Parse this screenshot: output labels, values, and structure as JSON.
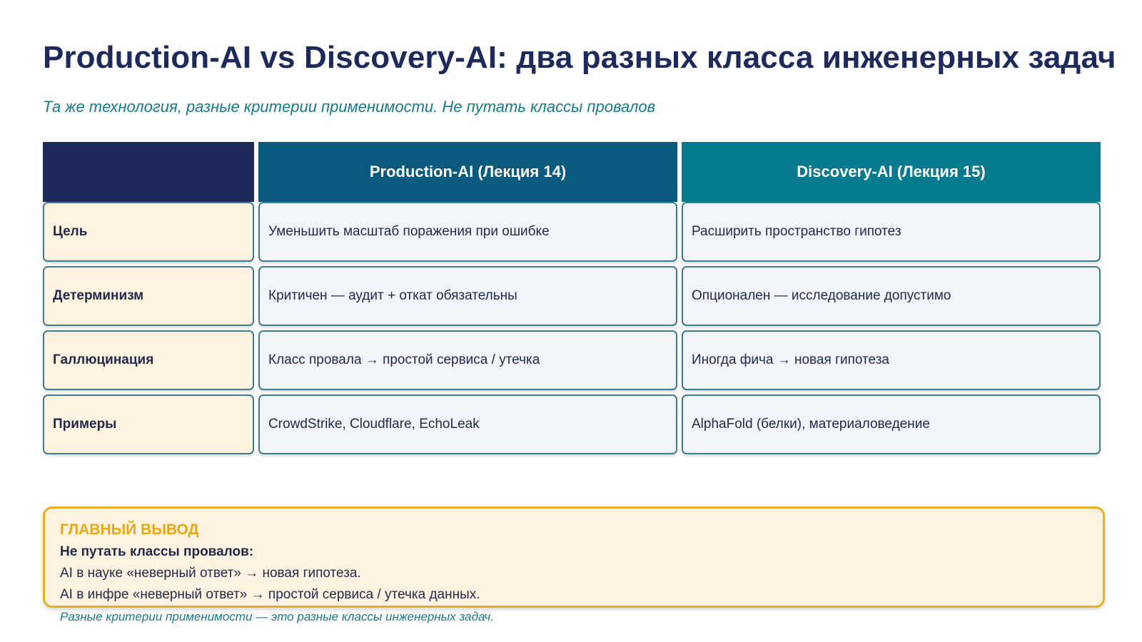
{
  "title": "Production-AI vs Discovery-AI: два разных класса инженерных задач",
  "subtitle": "Та же технология, разные критерии применимости. Не путать классы провалов",
  "colors": {
    "title": "#1f2a5c",
    "subtitle": "#167a8c",
    "header_corner": "#1f2a5c",
    "header_production": "#0b5a7e",
    "header_discovery": "#067b8f",
    "label_cell_bg": "#fdf3e0",
    "data_cell_bg": "#f1f5f9",
    "cell_border": "#3f7d8d",
    "conclusion_border": "#e8b020",
    "conclusion_label": "#e8a813"
  },
  "table": {
    "headers": [
      "",
      "Production-AI (Лекция 14)",
      "Discovery-AI (Лекция 15)"
    ],
    "rows": [
      {
        "label": "Цель",
        "production": "Уменьшить масштаб поражения при ошибке",
        "discovery": "Расширить пространство гипотез"
      },
      {
        "label": "Детерминизм",
        "production": "Критичен — аудит + откат обязательны",
        "discovery": "Опционален — исследование допустимо"
      },
      {
        "label": "Галлюцинация",
        "production": "Класс провала → простой сервиса / утечка",
        "discovery": "Иногда фича → новая гипотеза"
      },
      {
        "label": "Примеры",
        "production": "CrowdStrike, Cloudflare, EchoLeak",
        "discovery": "AlphaFold (белки), материаловедение"
      }
    ]
  },
  "conclusion": {
    "label": "ГЛАВНЫЙ ВЫВОД",
    "heading": "Не путать классы провалов:",
    "lines": [
      "AI в науке «неверный ответ» → новая гипотеза.",
      "AI в инфре «неверный ответ» → простой сервиса / утечка данных."
    ],
    "note": "Разные критерии применимости — это разные классы инженерных задач."
  }
}
